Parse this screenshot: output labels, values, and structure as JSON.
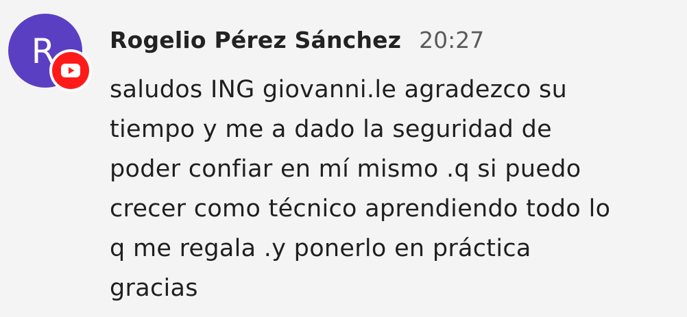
{
  "comment": {
    "avatar_letter": "R",
    "badge_icon": "youtube-icon",
    "author": "Rogelio Pérez Sánchez",
    "time": "20:27",
    "lines": [
      "saludos ING giovanni.le agradezco su",
      "tiempo y me a dado la seguridad de",
      "poder confiar en mí mismo .q si puedo",
      "crecer como técnico aprendiendo todo lo",
      "q me regala .y ponerlo en práctica",
      "gracias"
    ]
  },
  "colors": {
    "background": "#f4f4f4",
    "avatar": "#5b3fc2",
    "badge": "#ff1a1a"
  }
}
